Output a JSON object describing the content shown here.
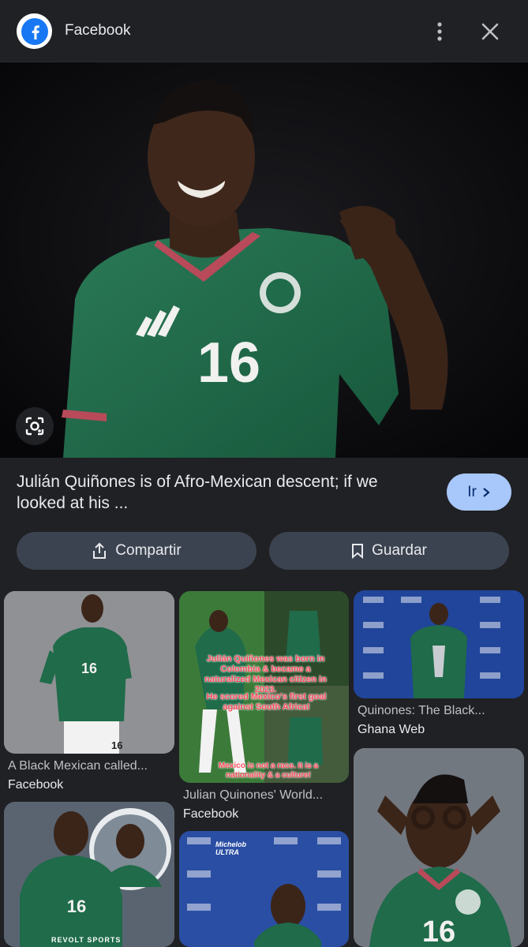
{
  "header": {
    "title": "Facebook"
  },
  "hero": {
    "jersey_number": "16"
  },
  "result": {
    "caption": "Julián Quiñones is of Afro-Mexican descent; if we looked at his ...",
    "go_label": "Ir",
    "share_label": "Compartir",
    "save_label": "Guardar"
  },
  "related": [
    {
      "title": "A Black Mexican called...",
      "source": "Facebook"
    },
    {
      "title": "Julian Quinones' World...",
      "source": "Facebook",
      "overlay_1": "Julián Quiñones was born in Colombia & became a naturalized Mexican citizen in 2023.",
      "overlay_2": "He scored Mexico's first goal against South Africa!",
      "overlay_3": "Mexico is not a race. It is a nationality & a culture!"
    },
    {
      "title": "Quinones: The Black...",
      "source": "Ghana Web"
    },
    {
      "watermark": "REVOLT SPORTS"
    },
    {
      "sponsor": "Michelob ULTRA"
    }
  ],
  "colors": {
    "background": "#202124",
    "accent_button": "#a8c7fa",
    "secondary_button": "#3c4350",
    "jersey_green": "#1f6b4a",
    "facebook_blue": "#1877f2"
  }
}
